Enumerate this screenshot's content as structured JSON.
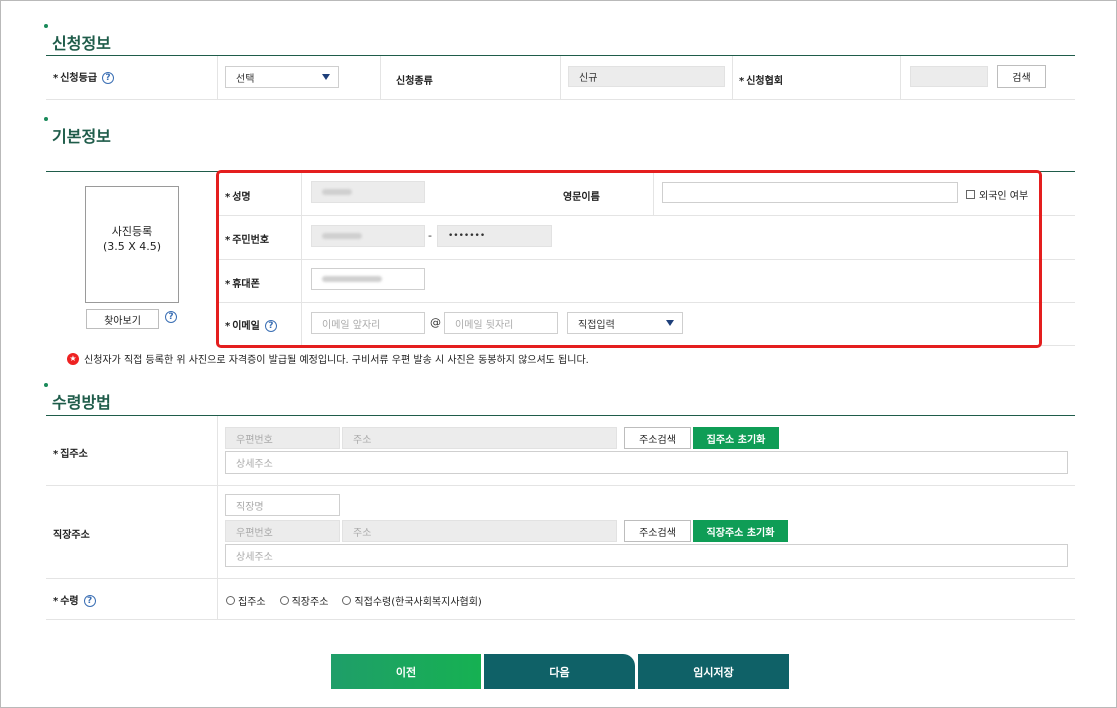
{
  "sections": {
    "apply_info": "신청정보",
    "basic_info": "기본정보",
    "receive_method": "수령방법"
  },
  "apply": {
    "grade_label": "신청등급",
    "grade_value": "선택",
    "type_label": "신청종류",
    "type_value": "신규",
    "assoc_label": "신청협회",
    "search_btn": "검색"
  },
  "basic": {
    "photo_line1": "사진등록",
    "photo_line2": "(3.5 X 4.5)",
    "browse_btn": "찾아보기",
    "name_label": "성명",
    "eng_name_label": "영문이름",
    "foreigner_label": "외국인 여부",
    "rrn_label": "주민번호",
    "rrn_back": "•••••••",
    "rrn_dash": "-",
    "phone_label": "휴대폰",
    "email_label": "이메일",
    "email_front_ph": "이메일 앞자리",
    "email_at": "@",
    "email_back_ph": "이메일 뒷자리",
    "email_domain": "직접입력",
    "notice": "신청자가 직접 등록한 위 사진으로 자격증이 발급될 예정입니다. 구비서류 우편 발송 시 사진은 동봉하지 않으셔도 됩니다."
  },
  "receive": {
    "home_label": "집주소",
    "zip_ph": "우편번호",
    "addr_ph": "주소",
    "detail_ph": "상세주소",
    "addr_search_btn": "주소검색",
    "home_reset_btn": "집주소 초기화",
    "work_label": "직장주소",
    "company_ph": "직장명",
    "work_reset_btn": "직장주소 초기화",
    "receive_label": "수령",
    "options": [
      "집주소",
      "직장주소",
      "직접수령(한국사회복지사협회)"
    ]
  },
  "buttons": {
    "prev": "이전",
    "next": "다음",
    "save": "임시저장"
  },
  "colors": {
    "section_title": "#1f5c4a",
    "green_button": "#0f9d56",
    "prev_button": "#1aa35f",
    "next_button": "#0f6167",
    "highlight": "#e41e1e"
  }
}
